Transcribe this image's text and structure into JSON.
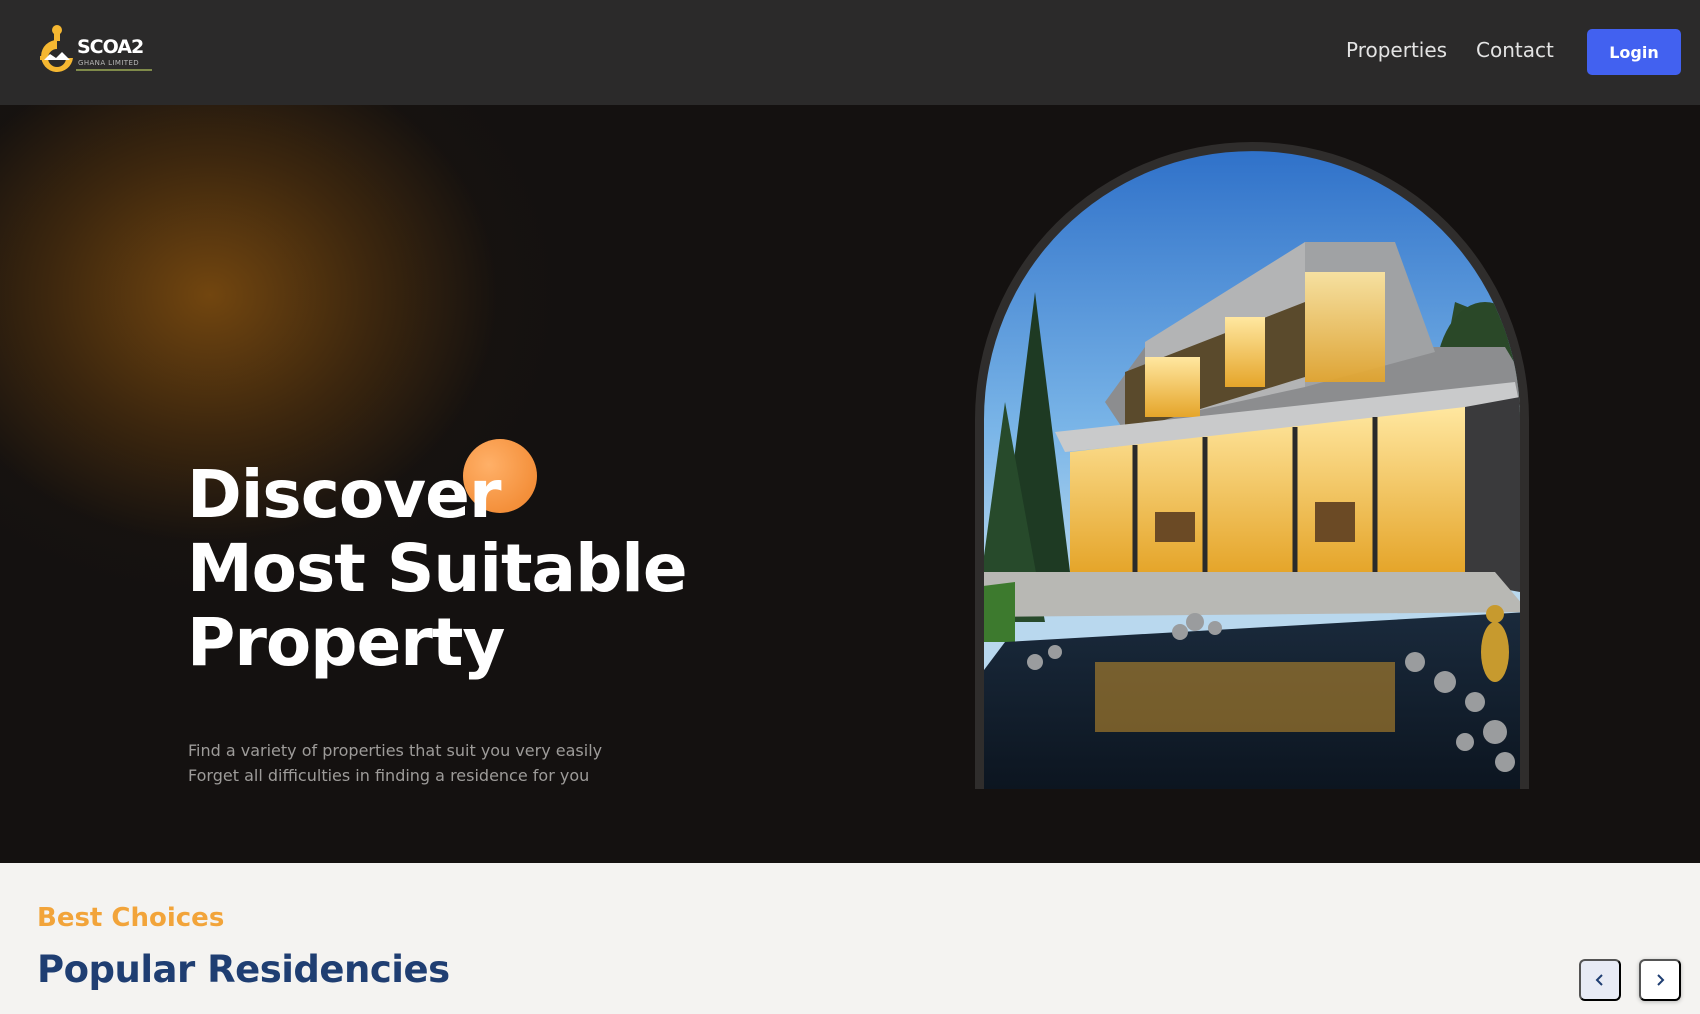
{
  "header": {
    "logo_text": "SCOA2",
    "logo_subtext": "GHANA LIMITED",
    "nav": {
      "properties": "Properties",
      "contact": "Contact"
    },
    "login_label": "Login"
  },
  "hero": {
    "title_lines": [
      "Discover",
      "Most Suitable",
      "Property"
    ],
    "subtitle_lines": [
      "Find a variety of properties that suit you very easily",
      "Forget all difficulties in finding a residence for you"
    ]
  },
  "residencies": {
    "kicker": "Best Choices",
    "title": "Popular Residencies"
  },
  "colors": {
    "header_bg": "#2b2a2a",
    "hero_bg": "#141110",
    "accent_blue": "#4261f0",
    "accent_orange": "#f4903b",
    "kicker_orange": "#f2a43a",
    "title_navy": "#1f3e72"
  },
  "icons": {
    "logo": "company-logo-icon",
    "prev": "chevron-left-icon",
    "next": "chevron-right-icon"
  }
}
